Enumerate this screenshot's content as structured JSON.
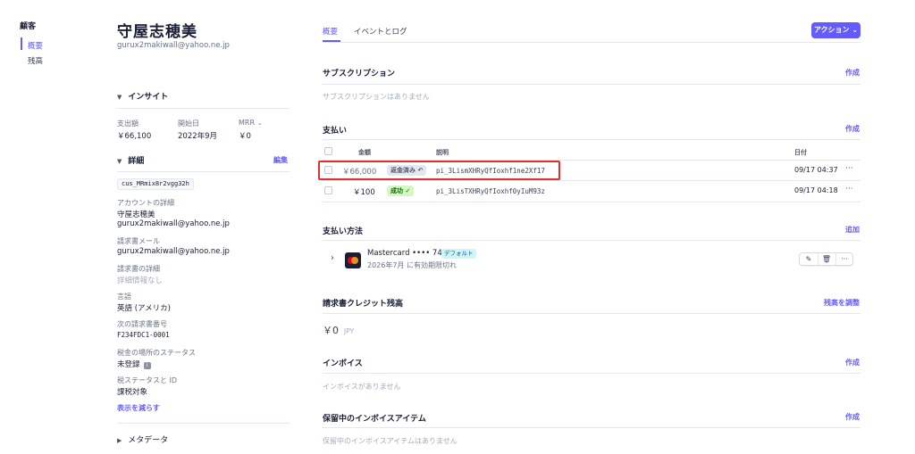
{
  "nav": {
    "title": "顧客",
    "items": [
      {
        "label": "概要",
        "active": true
      },
      {
        "label": "残高",
        "active": false
      }
    ]
  },
  "customer": {
    "name": "守屋志穂美",
    "email": "gurux2makiwall@yahoo.ne.jp"
  },
  "insights": {
    "heading": "インサイト",
    "metrics": [
      {
        "label": "支出額",
        "value": "￥66,100"
      },
      {
        "label": "開始日",
        "value": "2022年9月"
      },
      {
        "label": "MRR",
        "value": "￥0"
      }
    ]
  },
  "details": {
    "heading": "詳細",
    "edit_label": "編集",
    "customer_id": "cus_MRmix8r2vgg32h",
    "account_details_label": "アカウントの詳細",
    "account_name": "守屋志穂美",
    "account_email": "gurux2makiwall@yahoo.ne.jp",
    "invoice_email_label": "請求書メール",
    "invoice_email": "gurux2makiwall@yahoo.ne.jp",
    "invoice_details_label": "請求書の詳細",
    "invoice_details_value": "詳細情報なし",
    "language_label": "言語",
    "language_value": "英語 (アメリカ)",
    "next_invoice_label": "次の請求書番号",
    "next_invoice_value": "F234FDC1-0001",
    "tax_location_label": "税金の場所のステータス",
    "tax_location_value": "未登録",
    "tax_status_label": "税ステータスと ID",
    "tax_status_value": "課税対象",
    "show_less": "表示を減らす"
  },
  "metadata": {
    "heading": "メタデータ"
  },
  "tabs": [
    {
      "label": "概要",
      "active": true
    },
    {
      "label": "イベントとログ",
      "active": false
    }
  ],
  "action_button": "アクション",
  "subscriptions": {
    "heading": "サブスクリプション",
    "action": "作成",
    "empty": "サブスクリプションはありません"
  },
  "payments": {
    "heading": "支払い",
    "action": "作成",
    "columns": {
      "amount": "金額",
      "description": "説明",
      "date": "日付"
    },
    "rows": [
      {
        "amount": "￥66,000",
        "status": "返金済み",
        "status_icon": "undo-icon",
        "description": "pi_3LismXHRyQfIoxhf1ne2Xf17",
        "date": "09/17 04:37"
      },
      {
        "amount": "￥100",
        "status": "成功",
        "status_icon": "check-icon",
        "description": "pi_3LisTXHRyQfIoxhf0yIuM93z",
        "date": "09/17 04:18"
      }
    ]
  },
  "payment_methods": {
    "heading": "支払い方法",
    "action": "追加",
    "card_brand": "Mastercard",
    "card_masked": "•••• 7481",
    "default_badge": "デフォルト",
    "expiry": "2026年7月 に有効期限切れ"
  },
  "credit_balance": {
    "heading": "請求書クレジット残高",
    "action": "残高を調整",
    "amount": "￥0",
    "currency": "JPY"
  },
  "invoices": {
    "heading": "インボイス",
    "action": "作成",
    "empty": "インボイスがありません"
  },
  "pending_items": {
    "heading": "保留中のインボイスアイテム",
    "action": "作成",
    "empty": "保留中のインボイスアイテムはありません"
  },
  "colors": {
    "accent": "#635bff",
    "highlight": "#e03131",
    "success_bg": "#d7f7c2",
    "success_fg": "#05690d"
  }
}
